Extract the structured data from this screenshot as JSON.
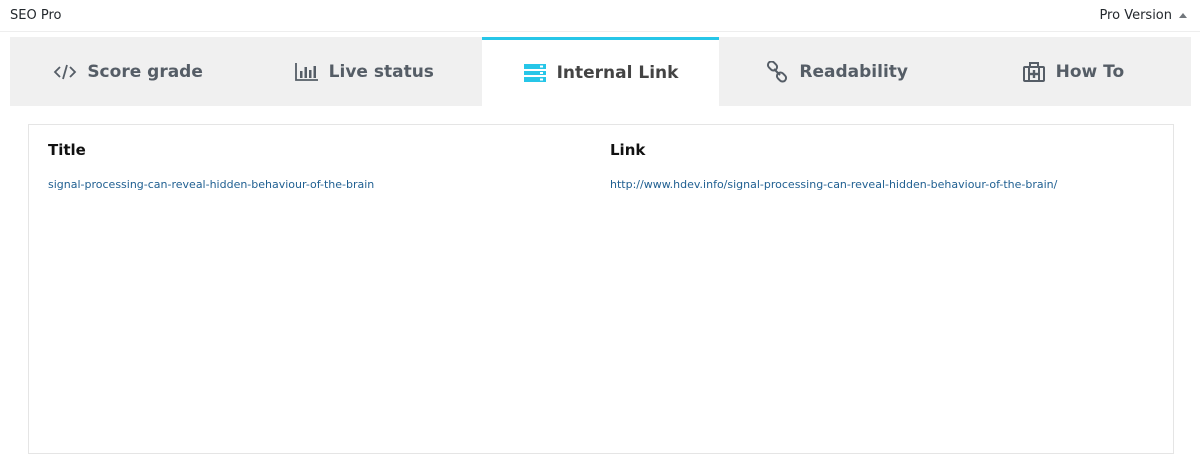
{
  "header": {
    "title": "SEO Pro",
    "version_label": "Pro Version"
  },
  "tabs": [
    {
      "label": "Score grade",
      "icon": "code-icon",
      "active": false
    },
    {
      "label": "Live status",
      "icon": "bar-chart-icon",
      "active": false
    },
    {
      "label": "Internal Link",
      "icon": "list-icon",
      "active": true
    },
    {
      "label": "Readability",
      "icon": "link-icon",
      "active": false
    },
    {
      "label": "How To",
      "icon": "first-aid-kit-icon",
      "active": false
    }
  ],
  "table": {
    "columns": [
      "Title",
      "Link"
    ],
    "rows": [
      {
        "title": "signal-processing-can-reveal-hidden-behaviour-of-the-brain",
        "link": "http://www.hdev.info/signal-processing-can-reveal-hidden-behaviour-of-the-brain/"
      }
    ]
  },
  "colors": {
    "active_accent": "#26c6e8",
    "tab_background": "#f0f0f0",
    "link": "#1f5f91"
  }
}
